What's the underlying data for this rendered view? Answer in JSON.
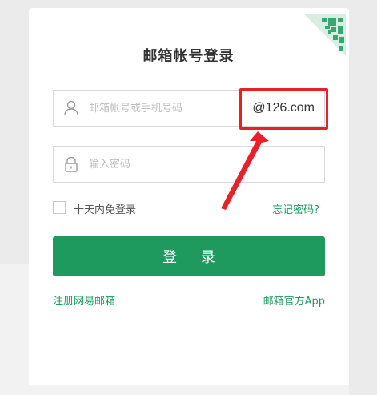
{
  "title": "邮箱帐号登录",
  "username": {
    "placeholder": "邮箱帐号或手机号码",
    "value": "",
    "suffix": "@126.com"
  },
  "password": {
    "placeholder": "输入密码",
    "value": ""
  },
  "remember": {
    "label": "十天内免登录",
    "checked": false
  },
  "forgot_label": "忘记密码?",
  "login_label": "登 录",
  "register_label": "注册网易邮箱",
  "app_label": "邮箱官方App",
  "icons": {
    "user": "user-icon",
    "lock": "lock-icon",
    "qr": "qr-code-corner-icon"
  },
  "colors": {
    "brand_green": "#1f9a5f",
    "annotation_red": "#e8202a"
  }
}
